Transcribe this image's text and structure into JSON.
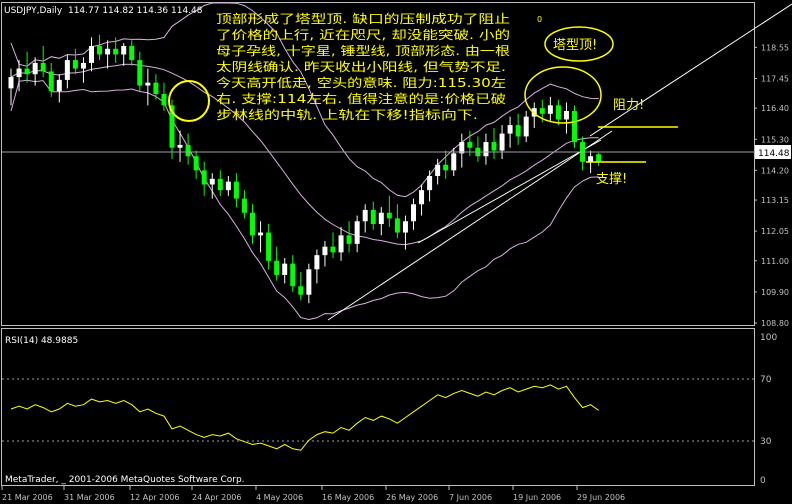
{
  "header": {
    "symbol_line": "USDJPY,Daily  114.77 114.82 114.36 114.48",
    "current_price": "114.48"
  },
  "annotations": {
    "commentary": [
      "顶部形成了塔型顶. 缺口的压制成功了阻止",
      "了价格的上行, 近在咫尺, 却没能突破. 小的",
      "母子孕线, 十字星, 锤型线, 顶部形态. 由一根",
      "太阴线确认. 昨天收出小阳线, 但气势不足.",
      "今天高开低走, 空头的意味. 阻力:115.30左",
      "右. 支撑:114左右. 值得注意的是:价格已破",
      "步林线的中轨. 上轨在下移!指标向下."
    ],
    "small_mark": "0",
    "tower_top": "塔型顶!",
    "resistance": "阻力!",
    "support": "支撑!"
  },
  "rsi": {
    "title": "RSI(14) 48.9885",
    "levels": [
      "100",
      "70",
      "30",
      "0"
    ]
  },
  "copyright": "MetaTrader, _ 2001-2006 MetaQuotes Software Corp.",
  "colors": {
    "background": "#000000",
    "grid_border": "#c0c0c0",
    "bull_candle": "#ffffff",
    "bear_candle": "#00ff00",
    "bollinger": "#d8b0e0",
    "rsi_line": "#ffff00",
    "annotation": "#ffff00",
    "trendline": "#ffffff"
  },
  "chart_data": {
    "type": "candlestick",
    "symbol": "USDJPY",
    "timeframe": "Daily",
    "ylim": [
      108.8,
      119.2
    ],
    "y_ticks": [
      "118.55",
      "117.45",
      "116.40",
      "115.30",
      "114.20",
      "113.15",
      "112.05",
      "111.00",
      "109.90",
      "108.80"
    ],
    "x_ticks": [
      "21 Mar 2006",
      "31 Mar 2006",
      "12 Apr 2006",
      "24 Apr 2006",
      "4 May 2006",
      "16 May 2006",
      "26 May 2006",
      "7 Jun 2006",
      "19 Jun 2006",
      "29 Jun 2006"
    ],
    "candles": [
      {
        "o": 117.1,
        "h": 117.8,
        "l": 116.5,
        "c": 117.5
      },
      {
        "o": 117.5,
        "h": 118.1,
        "l": 117.0,
        "c": 117.8
      },
      {
        "o": 117.8,
        "h": 118.4,
        "l": 117.3,
        "c": 117.6
      },
      {
        "o": 117.6,
        "h": 118.2,
        "l": 117.2,
        "c": 118.0
      },
      {
        "o": 118.0,
        "h": 118.6,
        "l": 117.5,
        "c": 117.7
      },
      {
        "o": 117.7,
        "h": 118.0,
        "l": 116.8,
        "c": 117.0
      },
      {
        "o": 117.0,
        "h": 117.6,
        "l": 116.6,
        "c": 117.4
      },
      {
        "o": 117.4,
        "h": 118.3,
        "l": 117.1,
        "c": 118.1
      },
      {
        "o": 118.1,
        "h": 118.5,
        "l": 117.6,
        "c": 117.8
      },
      {
        "o": 117.8,
        "h": 118.2,
        "l": 117.3,
        "c": 118.0
      },
      {
        "o": 118.0,
        "h": 118.9,
        "l": 117.7,
        "c": 118.6
      },
      {
        "o": 118.6,
        "h": 119.0,
        "l": 118.1,
        "c": 118.3
      },
      {
        "o": 118.3,
        "h": 118.8,
        "l": 117.8,
        "c": 118.5
      },
      {
        "o": 118.5,
        "h": 118.9,
        "l": 118.0,
        "c": 118.3
      },
      {
        "o": 118.3,
        "h": 118.7,
        "l": 117.9,
        "c": 118.6
      },
      {
        "o": 118.6,
        "h": 118.8,
        "l": 117.9,
        "c": 118.1
      },
      {
        "o": 118.1,
        "h": 118.4,
        "l": 117.0,
        "c": 117.2
      },
      {
        "o": 117.2,
        "h": 117.8,
        "l": 116.5,
        "c": 117.3
      },
      {
        "o": 117.3,
        "h": 117.6,
        "l": 116.7,
        "c": 116.9
      },
      {
        "o": 116.9,
        "h": 117.3,
        "l": 116.3,
        "c": 116.5
      },
      {
        "o": 116.5,
        "h": 116.7,
        "l": 114.6,
        "c": 115.0
      },
      {
        "o": 115.0,
        "h": 115.6,
        "l": 114.5,
        "c": 115.1
      },
      {
        "o": 115.1,
        "h": 115.5,
        "l": 114.4,
        "c": 114.7
      },
      {
        "o": 114.7,
        "h": 114.9,
        "l": 113.9,
        "c": 114.2
      },
      {
        "o": 114.2,
        "h": 114.5,
        "l": 113.3,
        "c": 113.7
      },
      {
        "o": 113.7,
        "h": 114.1,
        "l": 113.2,
        "c": 113.9
      },
      {
        "o": 113.9,
        "h": 114.2,
        "l": 113.3,
        "c": 113.5
      },
      {
        "o": 113.5,
        "h": 114.0,
        "l": 113.3,
        "c": 113.8
      },
      {
        "o": 113.8,
        "h": 114.1,
        "l": 112.9,
        "c": 113.2
      },
      {
        "o": 113.2,
        "h": 113.5,
        "l": 112.5,
        "c": 112.7
      },
      {
        "o": 112.7,
        "h": 113.0,
        "l": 111.6,
        "c": 111.9
      },
      {
        "o": 111.9,
        "h": 112.4,
        "l": 111.3,
        "c": 112.0
      },
      {
        "o": 112.0,
        "h": 112.3,
        "l": 110.7,
        "c": 111.0
      },
      {
        "o": 111.0,
        "h": 111.5,
        "l": 110.3,
        "c": 110.5
      },
      {
        "o": 110.5,
        "h": 111.1,
        "l": 110.2,
        "c": 110.9
      },
      {
        "o": 110.9,
        "h": 111.2,
        "l": 109.9,
        "c": 110.1
      },
      {
        "o": 110.1,
        "h": 110.6,
        "l": 109.6,
        "c": 109.8
      },
      {
        "o": 109.8,
        "h": 110.9,
        "l": 109.5,
        "c": 110.7
      },
      {
        "o": 110.7,
        "h": 111.4,
        "l": 110.2,
        "c": 111.2
      },
      {
        "o": 111.2,
        "h": 111.7,
        "l": 110.8,
        "c": 111.5
      },
      {
        "o": 111.5,
        "h": 112.0,
        "l": 111.1,
        "c": 111.3
      },
      {
        "o": 111.3,
        "h": 112.2,
        "l": 111.0,
        "c": 111.9
      },
      {
        "o": 111.9,
        "h": 112.4,
        "l": 111.3,
        "c": 111.6
      },
      {
        "o": 111.6,
        "h": 112.6,
        "l": 111.3,
        "c": 112.4
      },
      {
        "o": 112.4,
        "h": 113.0,
        "l": 112.0,
        "c": 112.8
      },
      {
        "o": 112.8,
        "h": 113.1,
        "l": 112.1,
        "c": 112.3
      },
      {
        "o": 112.3,
        "h": 112.9,
        "l": 111.9,
        "c": 112.7
      },
      {
        "o": 112.7,
        "h": 113.3,
        "l": 112.2,
        "c": 112.5
      },
      {
        "o": 112.5,
        "h": 113.0,
        "l": 111.8,
        "c": 112.0
      },
      {
        "o": 112.0,
        "h": 112.6,
        "l": 111.4,
        "c": 112.4
      },
      {
        "o": 112.4,
        "h": 113.2,
        "l": 112.1,
        "c": 113.0
      },
      {
        "o": 113.0,
        "h": 113.7,
        "l": 112.6,
        "c": 113.5
      },
      {
        "o": 113.5,
        "h": 114.2,
        "l": 113.1,
        "c": 114.0
      },
      {
        "o": 114.0,
        "h": 114.6,
        "l": 113.7,
        "c": 114.4
      },
      {
        "o": 114.4,
        "h": 114.9,
        "l": 113.9,
        "c": 114.2
      },
      {
        "o": 114.2,
        "h": 115.0,
        "l": 114.0,
        "c": 114.8
      },
      {
        "o": 114.8,
        "h": 115.5,
        "l": 114.3,
        "c": 115.2
      },
      {
        "o": 115.2,
        "h": 115.6,
        "l": 114.7,
        "c": 115.0
      },
      {
        "o": 115.0,
        "h": 115.4,
        "l": 114.5,
        "c": 114.7
      },
      {
        "o": 114.7,
        "h": 115.5,
        "l": 114.4,
        "c": 115.2
      },
      {
        "o": 115.2,
        "h": 115.7,
        "l": 114.6,
        "c": 114.9
      },
      {
        "o": 114.9,
        "h": 115.8,
        "l": 114.6,
        "c": 115.5
      },
      {
        "o": 115.5,
        "h": 116.1,
        "l": 115.0,
        "c": 115.8
      },
      {
        "o": 115.8,
        "h": 116.2,
        "l": 115.1,
        "c": 115.4
      },
      {
        "o": 115.4,
        "h": 116.3,
        "l": 115.2,
        "c": 116.1
      },
      {
        "o": 116.1,
        "h": 116.6,
        "l": 115.7,
        "c": 116.4
      },
      {
        "o": 116.4,
        "h": 116.7,
        "l": 115.9,
        "c": 116.2
      },
      {
        "o": 116.2,
        "h": 116.8,
        "l": 115.9,
        "c": 116.5
      },
      {
        "o": 116.5,
        "h": 116.7,
        "l": 115.8,
        "c": 116.0
      },
      {
        "o": 116.0,
        "h": 116.6,
        "l": 115.5,
        "c": 116.3
      },
      {
        "o": 116.3,
        "h": 116.5,
        "l": 115.0,
        "c": 115.2
      },
      {
        "o": 115.2,
        "h": 115.4,
        "l": 114.2,
        "c": 114.5
      },
      {
        "o": 114.5,
        "h": 114.9,
        "l": 114.1,
        "c": 114.7
      },
      {
        "o": 114.77,
        "h": 114.82,
        "l": 114.36,
        "c": 114.48
      }
    ],
    "rsi_values": [
      50,
      52,
      50,
      53,
      51,
      48,
      50,
      54,
      52,
      53,
      57,
      55,
      56,
      54,
      56,
      53,
      48,
      50,
      47,
      45,
      36,
      38,
      35,
      32,
      30,
      32,
      31,
      33,
      29,
      27,
      25,
      26,
      24,
      22,
      25,
      22,
      21,
      28,
      32,
      34,
      33,
      37,
      35,
      40,
      44,
      42,
      45,
      43,
      40,
      44,
      48,
      52,
      56,
      60,
      58,
      61,
      63,
      61,
      59,
      62,
      60,
      63,
      65,
      62,
      64,
      66,
      65,
      67,
      64,
      66,
      58,
      51,
      53,
      49
    ]
  }
}
